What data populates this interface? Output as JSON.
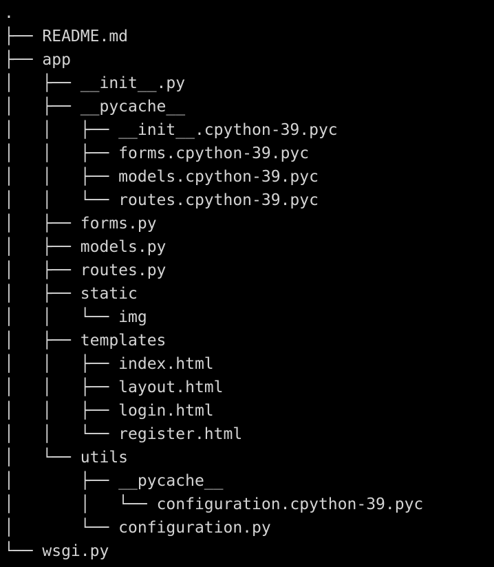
{
  "tree": {
    "root": ".",
    "rows": [
      {
        "prefix": "├── ",
        "name": "README.md"
      },
      {
        "prefix": "├── ",
        "name": "app"
      },
      {
        "prefix": "│   ├── ",
        "name": "__init__.py"
      },
      {
        "prefix": "│   ├── ",
        "name": "__pycache__"
      },
      {
        "prefix": "│   │   ├── ",
        "name": "__init__.cpython-39.pyc"
      },
      {
        "prefix": "│   │   ├── ",
        "name": "forms.cpython-39.pyc"
      },
      {
        "prefix": "│   │   ├── ",
        "name": "models.cpython-39.pyc"
      },
      {
        "prefix": "│   │   └── ",
        "name": "routes.cpython-39.pyc"
      },
      {
        "prefix": "│   ├── ",
        "name": "forms.py"
      },
      {
        "prefix": "│   ├── ",
        "name": "models.py"
      },
      {
        "prefix": "│   ├── ",
        "name": "routes.py"
      },
      {
        "prefix": "│   ├── ",
        "name": "static"
      },
      {
        "prefix": "│   │   └── ",
        "name": "img"
      },
      {
        "prefix": "│   ├── ",
        "name": "templates"
      },
      {
        "prefix": "│   │   ├── ",
        "name": "index.html"
      },
      {
        "prefix": "│   │   ├── ",
        "name": "layout.html"
      },
      {
        "prefix": "│   │   ├── ",
        "name": "login.html"
      },
      {
        "prefix": "│   │   └── ",
        "name": "register.html"
      },
      {
        "prefix": "│   └── ",
        "name": "utils"
      },
      {
        "prefix": "│       ├── ",
        "name": "__pycache__"
      },
      {
        "prefix": "│       │   └── ",
        "name": "configuration.cpython-39.pyc"
      },
      {
        "prefix": "│       └── ",
        "name": "configuration.py"
      },
      {
        "prefix": "└── ",
        "name": "wsgi.py"
      }
    ]
  }
}
